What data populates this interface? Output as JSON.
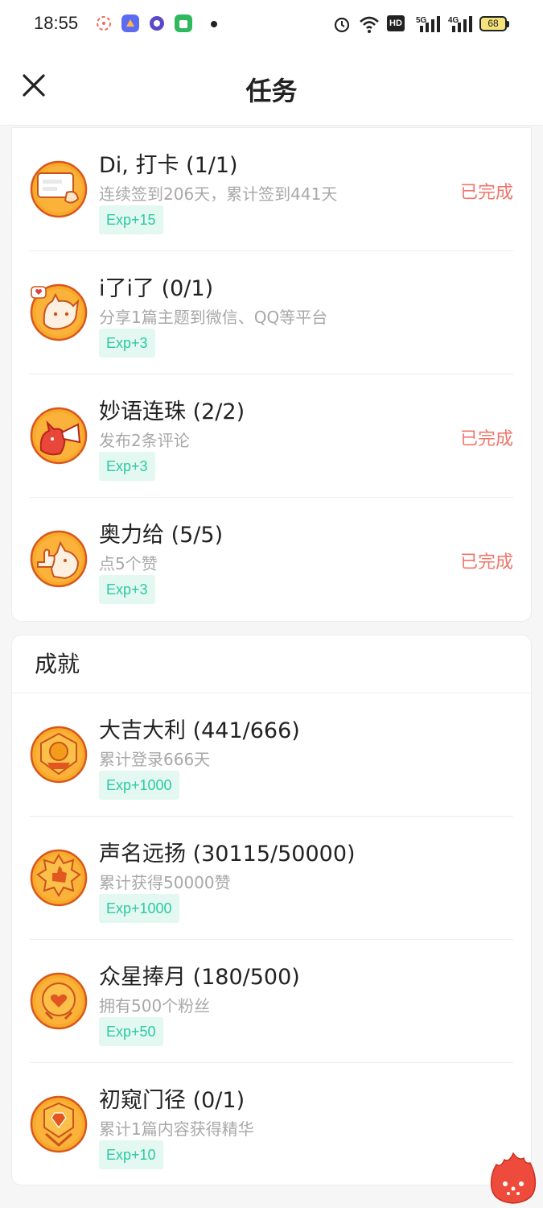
{
  "status_bar": {
    "time": "18:55",
    "hd_label": "HD",
    "net1": "5G",
    "net2": "4G",
    "battery": "68",
    "icons": [
      "pinwheel-icon",
      "app-shortcut-icon",
      "browser-icon",
      "android-app-icon",
      "alarm-icon",
      "wifi-icon",
      "signal-icon",
      "battery-icon"
    ]
  },
  "header": {
    "title": "任务",
    "close_icon": "close-icon"
  },
  "tasks": {
    "items": [
      {
        "title": "Di, 打卡 (1/1)",
        "desc": "连续签到206天，累计签到441天",
        "exp": "Exp+15",
        "status": "已完成",
        "icon": "checkin-card-icon"
      },
      {
        "title": "i了i了 (0/1)",
        "desc": "分享1篇主题到微信、QQ等平台",
        "exp": "Exp+3",
        "status": "",
        "icon": "share-cat-icon"
      },
      {
        "title": "妙语连珠 (2/2)",
        "desc": "发布2条评论",
        "exp": "Exp+3",
        "status": "已完成",
        "icon": "megaphone-devil-icon"
      },
      {
        "title": "奥力给 (5/5)",
        "desc": "点5个赞",
        "exp": "Exp+3",
        "status": "已完成",
        "icon": "thumbs-up-cat-icon"
      }
    ]
  },
  "achievements": {
    "title": "成就",
    "items": [
      {
        "title": "大吉大利 (441/666)",
        "desc": "累计登录666天",
        "exp": "Exp+1000",
        "icon": "fortune-medal-icon"
      },
      {
        "title": "声名远扬 (30115/50000)",
        "desc": "累计获得50000赞",
        "exp": "Exp+1000",
        "icon": "thumb-medal-icon"
      },
      {
        "title": "众星捧月 (180/500)",
        "desc": "拥有500个粉丝",
        "exp": "Exp+50",
        "icon": "heart-medal-icon"
      },
      {
        "title": "初窥门径 (0/1)",
        "desc": "累计1篇内容获得精华",
        "exp": "Exp+10",
        "icon": "diamond-medal-icon"
      }
    ]
  },
  "fab": {
    "icon": "flame-mascot-icon"
  },
  "colors": {
    "accent_exp": "#2cc9a4",
    "exp_bg": "#e3f8f1",
    "done": "#f0756b",
    "icon_orange": "#f7a928"
  }
}
